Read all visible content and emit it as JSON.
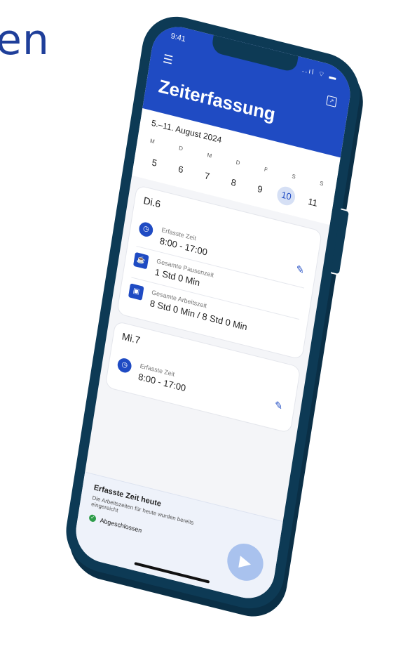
{
  "background_text": "en",
  "status": {
    "time": "9:41",
    "icons": "..ıl ⌔ ▬"
  },
  "header": {
    "title": "Zeiterfassung",
    "menu_icon": "menu-icon",
    "export_icon": "export-icon"
  },
  "week": {
    "range": "5.–11. August 2024",
    "days": [
      "M",
      "D",
      "M",
      "D",
      "F",
      "S",
      "S"
    ],
    "dates": [
      "5",
      "6",
      "7",
      "8",
      "9",
      "10",
      "11"
    ],
    "selected_date": "10"
  },
  "day_cards": [
    {
      "title": "Di.6",
      "rows": [
        {
          "label": "Erfasste Zeit",
          "value": "8:00 - 17:00",
          "icon": "clock-icon"
        },
        {
          "label": "Gesamte Pausenzeit",
          "value": "1 Std 0 Min",
          "icon": "coffee-icon"
        },
        {
          "label": "Gesamte Arbeitszeit",
          "value": "8 Std 0 Min / 8 Std 0 Min",
          "icon": "briefcase-icon"
        }
      ]
    },
    {
      "title": "Mi.7",
      "rows": [
        {
          "label": "Erfasste Zeit",
          "value": "8:00 - 17:00",
          "icon": "clock-icon"
        }
      ]
    }
  ],
  "bottom_panel": {
    "title": "Erfasste Zeit heute",
    "subtitle": "Die Arbeitszeiten für heute wurden bereits eingereicht",
    "status": "Abgeschlossen"
  },
  "colors": {
    "primary": "#1f4bc3",
    "frame": "#0d3a55",
    "success": "#2e9d4a",
    "fab": "#a9c2ee"
  }
}
